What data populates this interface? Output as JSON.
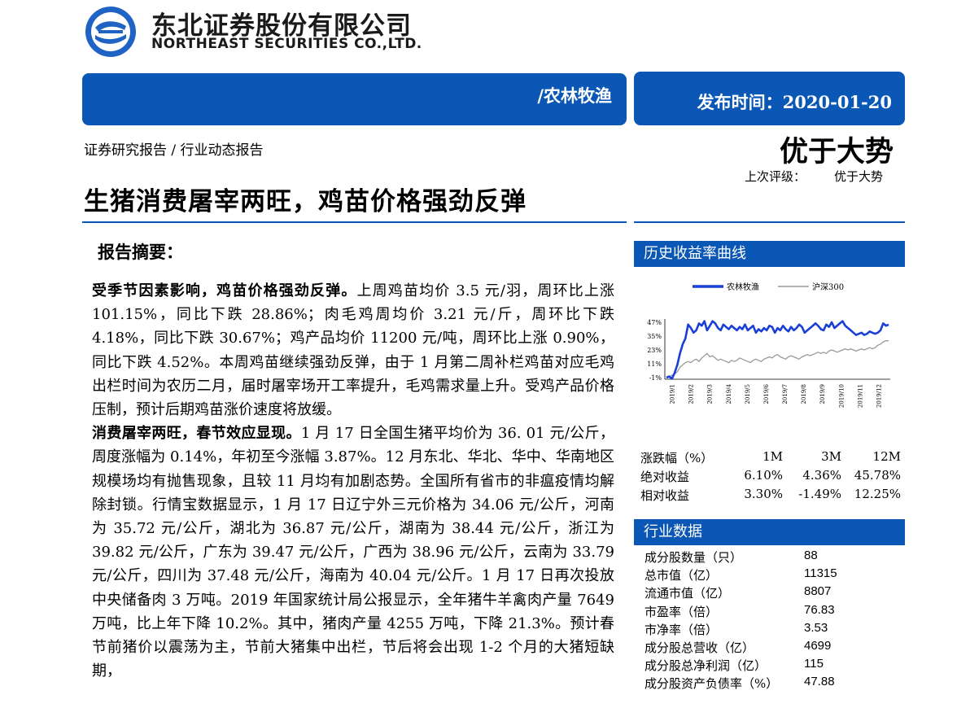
{
  "header": {
    "company_cn": "东北证券股份有限公司",
    "company_en": "NORTHEAST SECURITIES CO.,LTD.",
    "sector": "/农林牧渔",
    "publish": "发布时间：2020-01-20",
    "doc_type": "证券研究报告 / 行业动态报告",
    "rating": "优于大势",
    "prev_rating_label": "上次评级：",
    "prev_rating_value": "优于大势"
  },
  "headline": "生猪消费屠宰两旺，鸡苗价格强劲反弹",
  "summary_title": "报告摘要：",
  "para1_bold": "受季节因素影响，鸡苗价格强劲反弹。",
  "para1_text": "上周鸡苗均价 3.5 元/羽，周环比上涨 101.15%，同比下跌 28.86%；肉毛鸡周均价 3.21 元/斤，周环比下跌 4.18%，同比下跌 30.67%；鸡产品均价 11200 元/吨，周环比上涨 0.90%，同比下跌 4.52%。本周鸡苗继续强劲反弹，由于 1 月第二周补栏鸡苗对应毛鸡出栏时间为农历二月，届时屠宰场开工率提升，毛鸡需求量上升。受鸡产品价格压制，预计后期鸡苗涨价速度将放缓。",
  "para2_bold": "消费屠宰两旺，春节效应显现。",
  "para2_text": "1 月 17 日全国生猪平均价为 36. 01 元/公斤，周度涨幅为 0.14%，年初至今涨幅 3.87%。12 月东北、华北、华中、华南地区规模场均有抛售现象，且较 11 月均有加剧态势。全国所有省市的非瘟疫情均解除封锁。行情宝数据显示，1 月 17 日辽宁外三元价格为 34.06 元/公斤，河南为 35.72 元/公斤，湖北为 36.87 元/公斤，湖南为 38.44 元/公斤，浙江为 39.82 元/公斤，广东为 39.47 元/公斤，广西为 38.96 元/公斤，云南为 33.79 元/公斤，四川为 37.48 元/公斤，海南为 40.04 元/公斤。1 月 17 日再次投放中央储备肉 3 万吨。2019 年国家统计局公报显示，全年猪牛羊禽肉产量 7649 万吨，比上年下降 10.2%。其中，猪肉产量 4255 万吨，下降 21.3%。预计春节前猪价以震荡为主，节前大猪集中出栏，节后将会出现 1-2 个月的大猪短缺期，",
  "history_title": "历史收益率曲线",
  "chart_data": {
    "type": "line",
    "series": [
      {
        "name": "农林牧渔",
        "color": "#1a3fd6",
        "values": [
          -1,
          0,
          -2,
          3,
          10,
          20,
          28,
          33,
          45,
          42,
          38,
          40,
          46,
          44,
          48,
          40,
          44,
          48,
          46,
          42,
          40,
          45,
          43,
          41,
          44,
          42,
          40,
          43,
          41,
          45,
          40,
          42,
          44,
          38,
          41,
          39,
          42,
          40,
          44,
          43,
          38,
          42,
          40,
          44,
          41,
          39,
          43,
          40,
          42,
          45,
          43,
          38,
          40,
          42,
          44,
          46,
          44,
          41,
          40,
          45,
          43,
          47,
          42,
          44,
          46,
          48,
          44,
          42,
          40,
          38,
          36,
          37,
          38,
          36,
          37,
          39,
          38,
          37,
          38,
          40,
          46,
          44,
          45
        ]
      },
      {
        "name": "沪深300",
        "color": "#9a9a9a",
        "values": [
          -1,
          0,
          1,
          2,
          4,
          8,
          10,
          12,
          13,
          12,
          14,
          15,
          13,
          16,
          18,
          20,
          17,
          18,
          16,
          14,
          15,
          14,
          13,
          12,
          14,
          13,
          14,
          16,
          15,
          14,
          13,
          12,
          14,
          15,
          14,
          13,
          15,
          16,
          17,
          16,
          18,
          19,
          17,
          16,
          15,
          17,
          18,
          17,
          16,
          15,
          17,
          18,
          19,
          18,
          19,
          20,
          21,
          20,
          21,
          20,
          22,
          23,
          22,
          21,
          22,
          23,
          24,
          23,
          24,
          23,
          22,
          23,
          24,
          23,
          24,
          25,
          24,
          25,
          27,
          28,
          30,
          31,
          31
        ]
      }
    ],
    "yticks": [
      "47%",
      "35%",
      "23%",
      "11%",
      "-1%"
    ],
    "ytick_values": [
      47,
      35,
      23,
      11,
      -1
    ],
    "xticks": [
      "2019/1",
      "2019/2",
      "2019/3",
      "2019/4",
      "2019/5",
      "2019/6",
      "2019/7",
      "2019/8",
      "2019/9",
      "2019/10",
      "2019/11",
      "2019/12"
    ],
    "ylim": [
      -1,
      47
    ]
  },
  "performance": {
    "header": [
      "涨跌幅（%）",
      "1M",
      "3M",
      "12M"
    ],
    "rows": [
      [
        "绝对收益",
        "6.10%",
        "4.36%",
        "45.78%"
      ],
      [
        "相对收益",
        "3.30%",
        "-1.49%",
        "12.25%"
      ]
    ]
  },
  "industry_title": "行业数据",
  "industry": [
    [
      "成分股数量（只）",
      "88"
    ],
    [
      "总市值（亿）",
      "11315"
    ],
    [
      "流通市值（亿）",
      "8807"
    ],
    [
      "市盈率（倍）",
      "76.83"
    ],
    [
      "市净率（倍）",
      "3.53"
    ],
    [
      "成分股总营收（亿）",
      "4699"
    ],
    [
      "成分股总净利润（亿）",
      "115"
    ],
    [
      "成分股资产负债率（%）",
      "47.88"
    ]
  ]
}
